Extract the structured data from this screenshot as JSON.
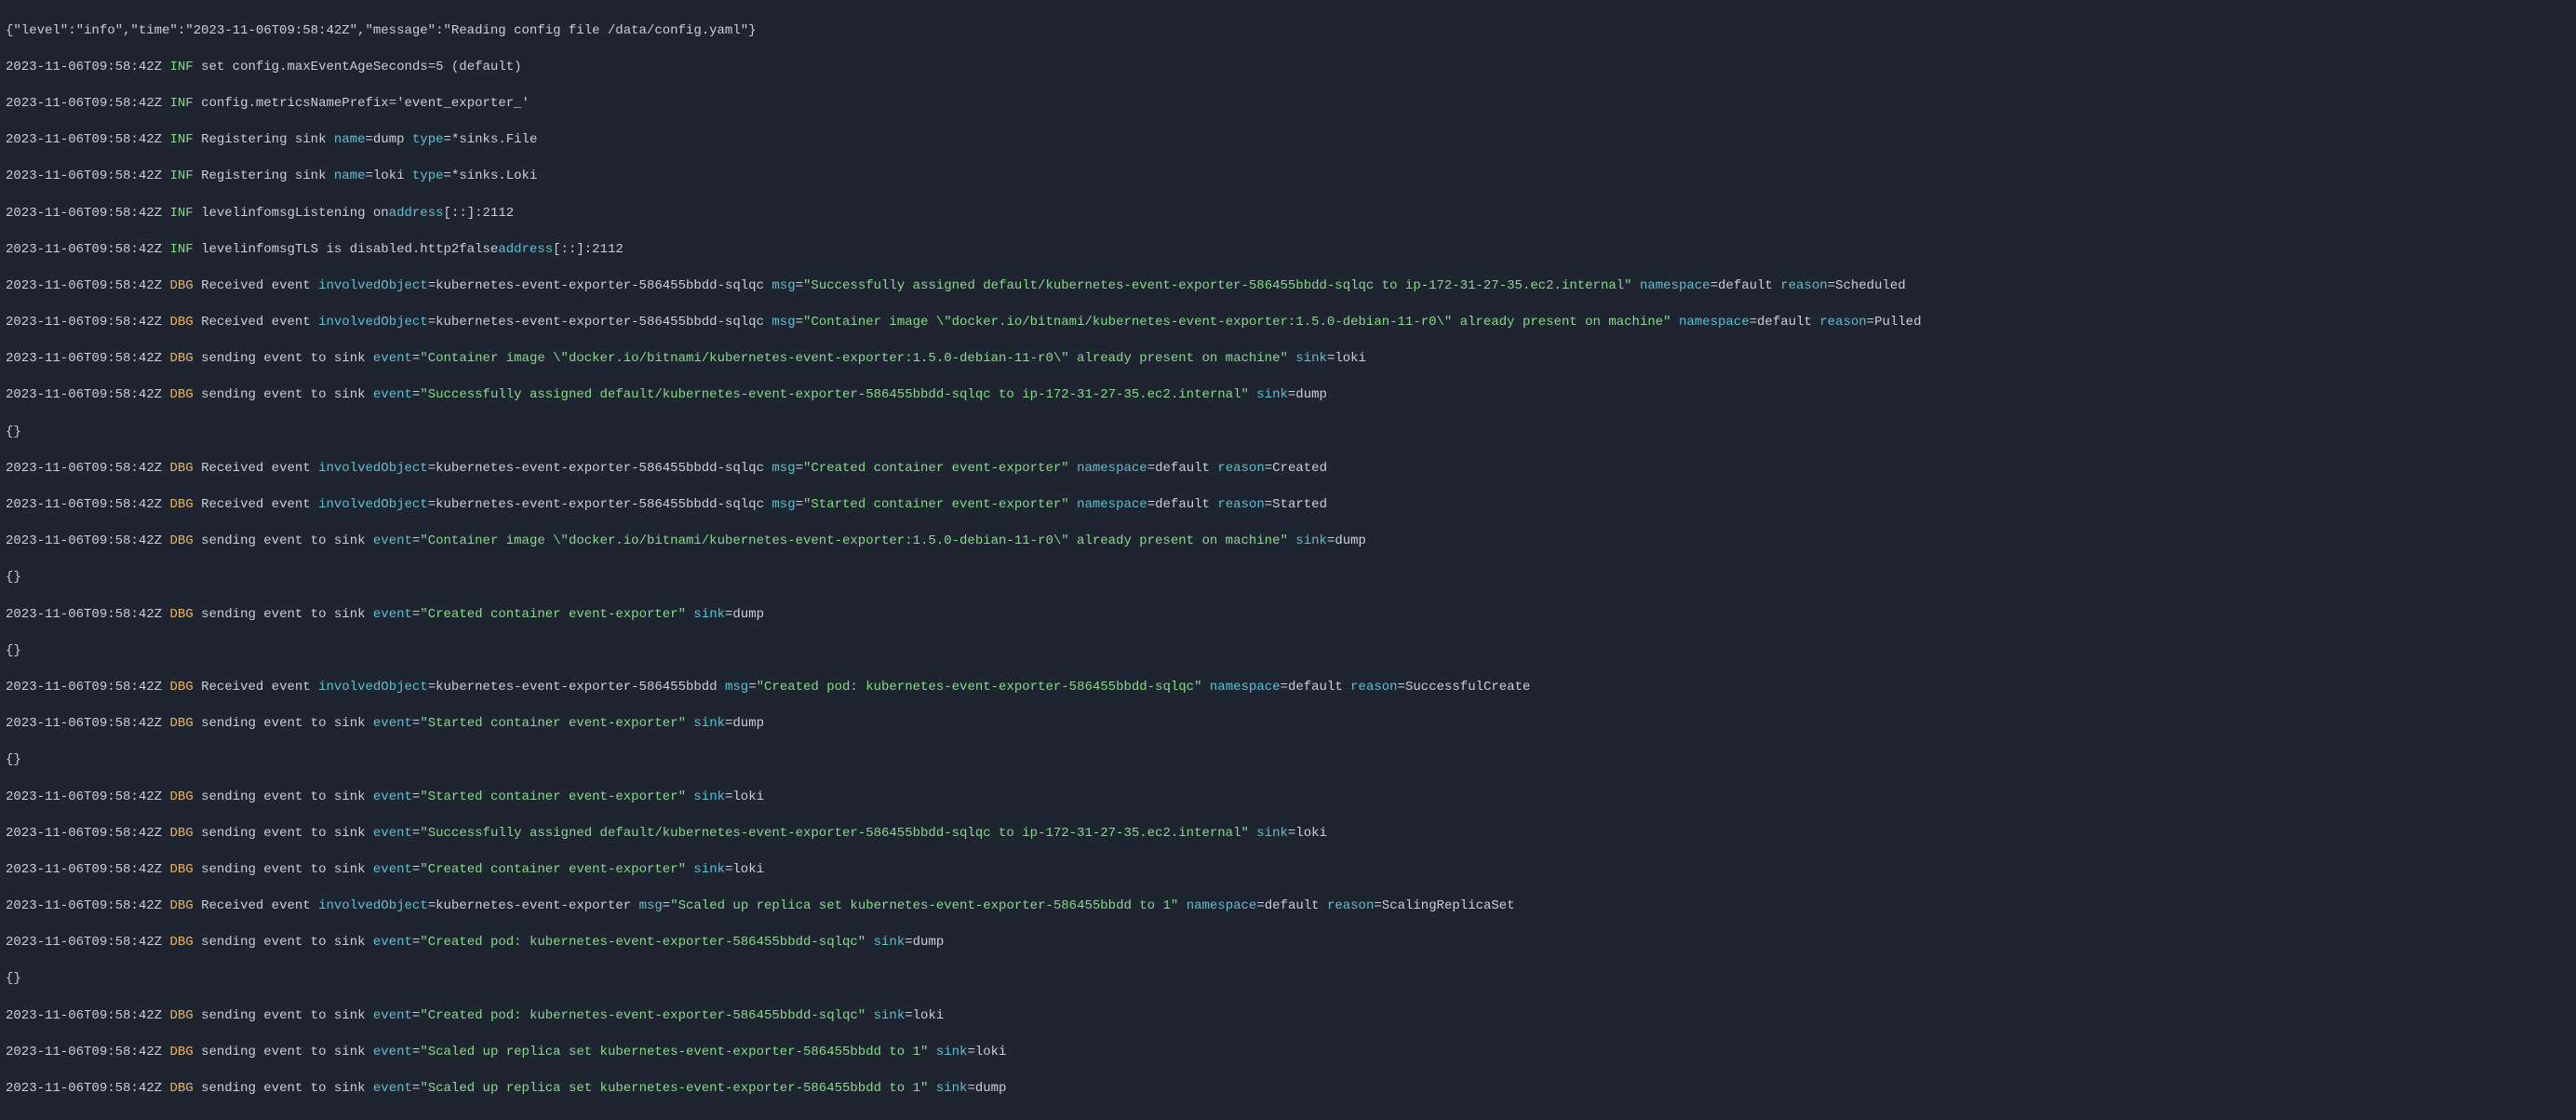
{
  "terminal": {
    "jsonHeader": "{\"level\":\"info\",\"time\":\"2023-11-06T09:58:42Z\",\"message\":\"Reading config file /data/config.yaml\"}",
    "ts": "2023-11-06T09:58:42Z",
    "lvlInf": "INF",
    "lvlDbg": "DBG",
    "empty": "{}",
    "lines": {
      "l1_body": "set config.maxEventAgeSeconds=5 (default)",
      "l2_body": "config.metricsNamePrefix='event_exporter_'",
      "l3_pre": "Registering sink ",
      "l3_nameKey": "name",
      "l3_nameVal": "dump",
      "l3_typeKey": "type",
      "l3_typeVal": "*sinks.File",
      "l4_nameVal": "loki",
      "l4_typeVal": "*sinks.Loki",
      "l5_pre": "levelinfomsgListening on",
      "l5_addrKey": "address",
      "l5_addrVal": "[::]:2112",
      "l6_pre": "levelinfomsgTLS is disabled.http2false",
      "l6_addrKey": "address",
      "l6_addrVal": "[::]:2112",
      "recv": "Received event ",
      "send": "sending event to sink ",
      "ioKey": "involvedObject",
      "msgKey": "msg",
      "nsKey": "namespace",
      "rsnKey": "reason",
      "evKey": "event",
      "sinkKey": "sink",
      "ioValPod": "kubernetes-event-exporter-586455bbdd-sqlqc",
      "ioValRs": "kubernetes-event-exporter-586455bbdd",
      "ioValDep": "kubernetes-event-exporter",
      "nsDefault": "default",
      "sinkLoki": "loki",
      "sinkDump": "dump",
      "msgAssigned": "\"Successfully assigned default/kubernetes-event-exporter-586455bbdd-sqlqc to ip-172-31-27-35.ec2.internal\"",
      "msgImage": "\"Container image \\\"docker.io/bitnami/kubernetes-event-exporter:1.5.0-debian-11-r0\\\" already present on machine\"",
      "msgCreatedCtr": "\"Created container event-exporter\"",
      "msgStartedCtr": "\"Started container event-exporter\"",
      "msgCreatedPod": "\"Created pod: kubernetes-event-exporter-586455bbdd-sqlqc\"",
      "msgScaled": "\"Scaled up replica set kubernetes-event-exporter-586455bbdd to 1\"",
      "rsnScheduled": "Scheduled",
      "rsnPulled": "Pulled",
      "rsnCreated": "Created",
      "rsnStarted": "Started",
      "rsnSuccCreate": "SuccessfulCreate",
      "rsnScaling": "ScalingReplicaSet"
    }
  }
}
